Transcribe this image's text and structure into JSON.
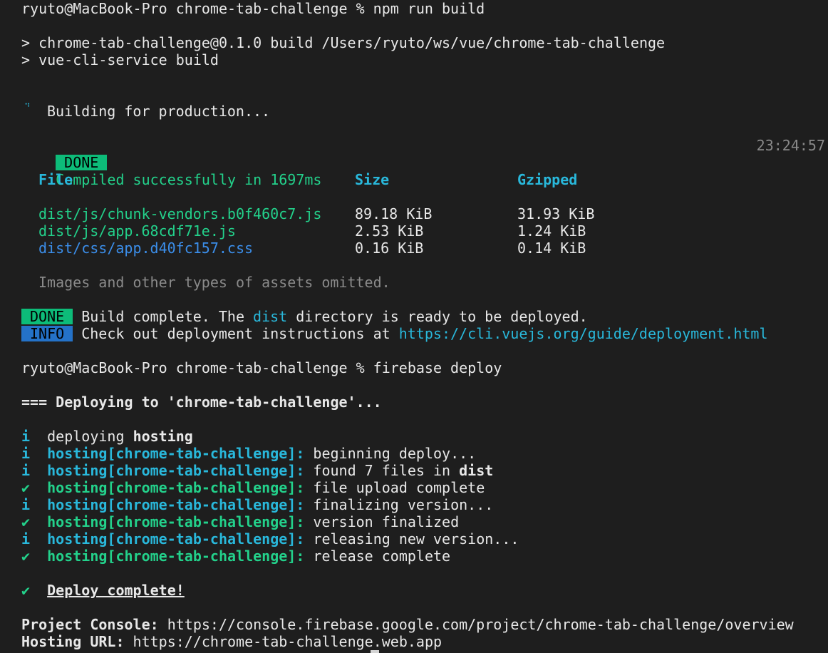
{
  "colors": {
    "background": "#1e1e1e",
    "green": "#23d18b",
    "cyan": "#29b8db",
    "blue": "#3b8eea",
    "badge_done": "#0dbc79",
    "badge_info": "#2472c8"
  },
  "build": {
    "prompt": "ryuto@MacBook-Pro chrome-tab-challenge % npm run build",
    "script1": "> chrome-tab-challenge@0.1.0 build /Users/ryuto/ws/vue/chrome-tab-challenge",
    "script2": "> vue-cli-service build",
    "spinner": "⠙",
    "building": "Building for production...",
    "done_badge": "DONE",
    "compiled": "Compiled successfully in 1697ms",
    "time": "23:24:57",
    "headers": {
      "file": "File",
      "size": "Size",
      "gzipped": "Gzipped"
    },
    "files": [
      {
        "file": "dist/js/chunk-vendors.b0f460c7.js",
        "size": "89.18 KiB",
        "gzipped": "31.93 KiB"
      },
      {
        "file": "dist/js/app.68cdf71e.js",
        "size": "2.53 KiB",
        "gzipped": "1.24 KiB"
      },
      {
        "file": "dist/css/app.d40fc157.css",
        "size": "0.16 KiB",
        "gzipped": "0.14 KiB"
      }
    ],
    "omitted": "Images and other types of assets omitted.",
    "complete_pre": "Build complete. The ",
    "complete_dir": "dist",
    "complete_post": " directory is ready to be deployed.",
    "info_badge": "INFO",
    "info_text": "Check out deployment instructions at ",
    "info_link": "https://cli.vuejs.org/guide/deployment.html"
  },
  "deploy": {
    "prompt": "ryuto@MacBook-Pro chrome-tab-challenge % firebase deploy",
    "heading": "=== Deploying to 'chrome-tab-challenge'...",
    "deploying_icon": "i",
    "deploying_pre": "deploying ",
    "deploying_bold": "hosting",
    "target": "hosting[chrome-tab-challenge]:",
    "steps": [
      {
        "icon": "i",
        "msg": "beginning deploy..."
      },
      {
        "icon": "i",
        "msg": "found 7 files in ",
        "bold": "dist"
      },
      {
        "icon": "✔",
        "msg": "file upload complete"
      },
      {
        "icon": "i",
        "msg": "finalizing version..."
      },
      {
        "icon": "✔",
        "msg": "version finalized"
      },
      {
        "icon": "i",
        "msg": "releasing new version..."
      },
      {
        "icon": "✔",
        "msg": "release complete"
      }
    ],
    "complete_icon": "✔",
    "complete": "Deploy complete!",
    "console_label": "Project Console:",
    "console_url": "https://console.firebase.google.com/project/chrome-tab-challenge/overview",
    "hosting_label": "Hosting URL:",
    "hosting_url": "https://chrome-tab-challenge.web.app"
  }
}
